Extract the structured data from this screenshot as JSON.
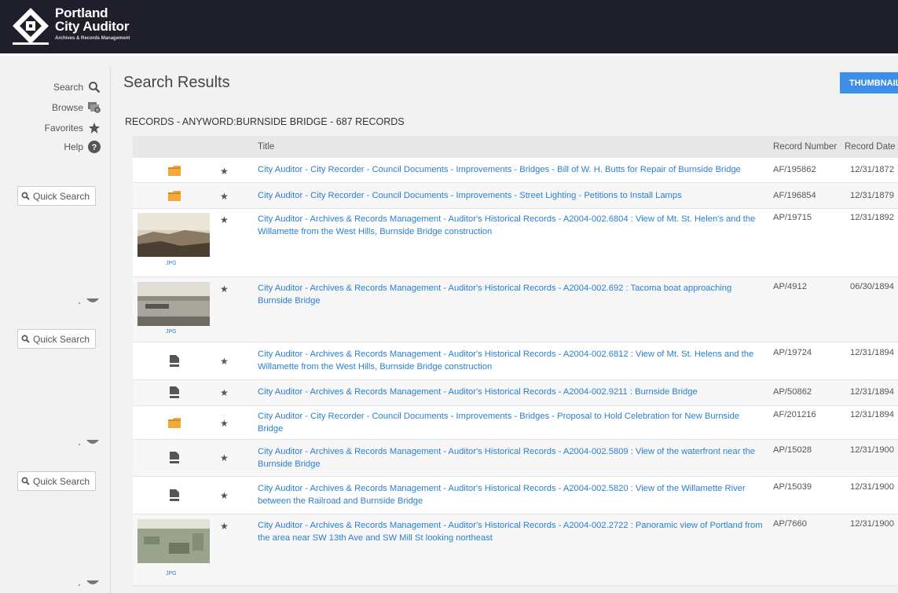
{
  "header": {
    "logo_line1": "Portland",
    "logo_line2": "City Auditor",
    "logo_sub": "Archives & Records Management"
  },
  "sidebar": {
    "items": [
      {
        "label": "Search",
        "icon": "search-icon"
      },
      {
        "label": "Browse",
        "icon": "browse-icon"
      },
      {
        "label": "Favorites",
        "icon": "star-icon"
      },
      {
        "label": "Help",
        "icon": "help-icon"
      }
    ],
    "quick_search_placeholder": "Quick Search"
  },
  "main": {
    "title": "Search Results",
    "thumbnails_button": "THUMBNAILS",
    "results_heading": "RECORDS - ANYWORD:BURNSIDE BRIDGE - 687 RECORDS",
    "columns": {
      "title": "Title",
      "record_number": "Record Number",
      "record_date": "Record Date"
    }
  },
  "records": [
    {
      "type": "folder",
      "title": "City Auditor - City Recorder - Council Documents - Improvements - Bridges - Bill of W. H. Butts for Repair of Burnside Bridge",
      "number": "AF/195862",
      "date": "12/31/1872"
    },
    {
      "type": "folder",
      "title": "City Auditor - City Recorder - Council Documents - Improvements - Street Lighting - Petitions to Install Lamps",
      "number": "AF/196854",
      "date": "12/31/1879"
    },
    {
      "type": "image",
      "format": "JPG",
      "title": "City Auditor - Archives & Records Management - Auditor's Historical Records - A2004-002.6804 : View of Mt. St. Helen's and the Willamette from the West Hills, Burnside Bridge construction",
      "number": "AP/19715",
      "date": "12/31/1892"
    },
    {
      "type": "image",
      "format": "JPG",
      "title": "City Auditor - Archives & Records Management - Auditor's Historical Records - A2004-002.692 : Tacoma boat approaching Burnside Bridge",
      "number": "AP/4912",
      "date": "06/30/1894"
    },
    {
      "type": "document",
      "title": "City Auditor - Archives & Records Management - Auditor's Historical Records - A2004-002.6812 : View of Mt. St. Helens and the Willamette from the West Hills, Burnside Bridge construction",
      "number": "AP/19724",
      "date": "12/31/1894"
    },
    {
      "type": "document",
      "title": "City Auditor - Archives & Records Management - Auditor's Historical Records - A2004-002.9211 : Burnside Bridge",
      "number": "AP/50862",
      "date": "12/31/1894"
    },
    {
      "type": "folder",
      "title": "City Auditor - City Recorder - Council Documents - Improvements - Bridges - Proposal to Hold Celebration for New Burnside Bridge",
      "number": "AF/201216",
      "date": "12/31/1894"
    },
    {
      "type": "document",
      "title": "City Auditor - Archives & Records Management - Auditor's Historical Records - A2004-002.5809 : View of the waterfront near the Burnside Bridge",
      "number": "AP/15028",
      "date": "12/31/1900"
    },
    {
      "type": "document",
      "title": "City Auditor - Archives & Records Management - Auditor's Historical Records - A2004-002.5820 : View of the Willamette River between the Railroad and Burnside Bridge",
      "number": "AP/15039",
      "date": "12/31/1900"
    },
    {
      "type": "image",
      "format": "JPG",
      "title": "City Auditor - Archives & Records Management - Auditor's Historical Records - A2004-002.2722 : Panoramic view of Portland from the area near SW 13th Ave and SW Mill St looking northeast",
      "number": "AP/7660",
      "date": "12/31/1900"
    }
  ],
  "colors": {
    "header_bg": "#1e1f2b",
    "link": "#2a7fd0",
    "button": "#3d8ee6",
    "folder": "#f0a93b"
  }
}
